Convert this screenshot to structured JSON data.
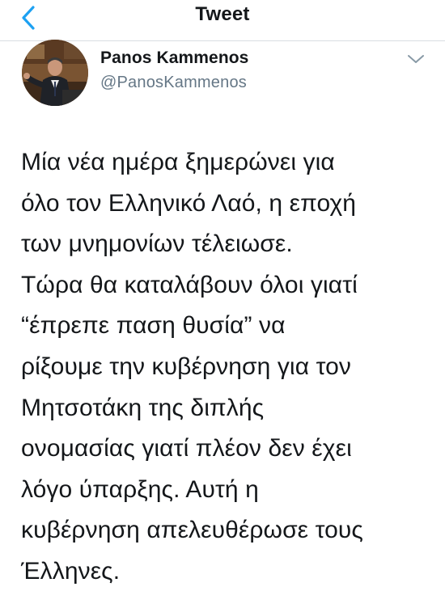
{
  "header": {
    "title": "Tweet",
    "back_icon": "chevron-left-icon",
    "accent_color": "#1da1f2"
  },
  "author": {
    "name": "Panos Kammenos",
    "handle": "@PanosKammenos",
    "avatar_icon": "avatar-photo",
    "more_icon": "chevron-down-icon"
  },
  "tweet": {
    "lines": [
      "Μία νέα ημέρα ξημερώνει για",
      "όλο τον Ελληνικό Λαό, η εποχή",
      "των μνημονίων τέλειωσε.",
      "Τώρα θα καταλάβουν όλοι γιατί",
      "“έπρεπε παση θυσία” να",
      "ρίξουμε την κυβέρνηση για τον",
      "Μητσοτάκη της διπλής",
      "ονομασίας γιατί πλέον δεν έχει",
      "λόγο ύπαρξης.  Αυτή η",
      "κυβέρνηση απελευθέρωσε τους",
      "Έλληνες."
    ]
  }
}
